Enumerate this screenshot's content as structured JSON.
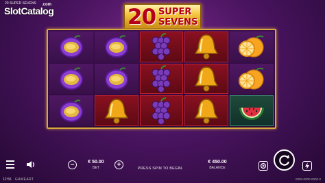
{
  "watermark": {
    "small": "20 SUPER SEVENS",
    "main": "SlotCatalog",
    "com": ".com"
  },
  "logo": {
    "number": "20",
    "line1": "SUPER",
    "line2": "SEVENS"
  },
  "reels": [
    [
      "plum",
      "plum",
      "grapes",
      "bell",
      "orange"
    ],
    [
      "plum",
      "plum",
      "grapes",
      "bell",
      "orange"
    ],
    [
      "plum",
      "bell",
      "grapes",
      "bell",
      "watermelon"
    ]
  ],
  "highlights": [
    [
      "none",
      "none",
      "hl",
      "hl",
      "none"
    ],
    [
      "none",
      "none",
      "hl",
      "hl",
      "none"
    ],
    [
      "none",
      "hl",
      "hl",
      "hl",
      "green"
    ]
  ],
  "controls": {
    "bet_value": "€ 50.00",
    "bet_label": "BET",
    "message": "PRESS SPIN TO BEGIN.",
    "balance_value": "€ 450.00",
    "balance_label": "BALANCE",
    "minus_symbol": "−",
    "plus_symbol": "+"
  },
  "status": {
    "clock": "12:56",
    "brand": "GAMEART",
    "version": "0000-0000-0000-0"
  },
  "colors": {
    "accent_gold": "#d9a83a",
    "highlight_red": "#8a1020",
    "background": "#4a1460"
  }
}
